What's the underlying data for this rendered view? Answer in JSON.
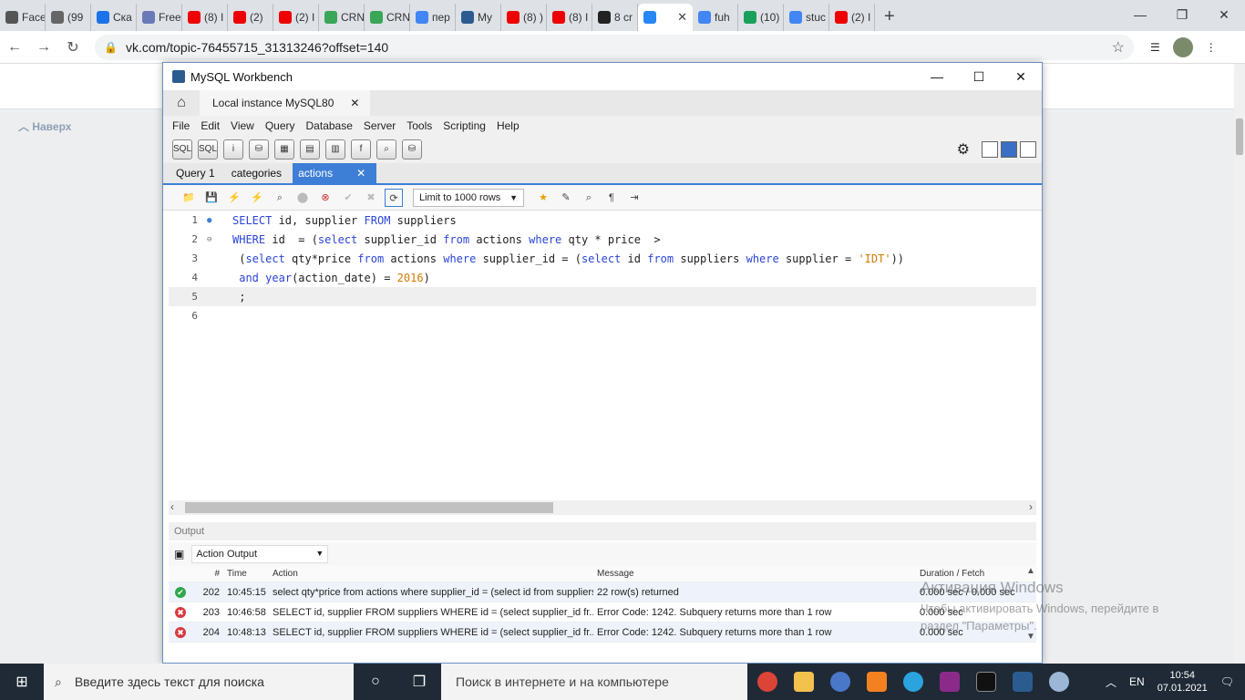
{
  "browser": {
    "tabs": [
      {
        "label": "Face",
        "color": "#555"
      },
      {
        "label": "(99",
        "color": "#666"
      },
      {
        "label": "Ска",
        "color": "#1a73e8"
      },
      {
        "label": "Free",
        "color": "#6a7ab8"
      },
      {
        "label": "(8) I",
        "color": "#e00"
      },
      {
        "label": "(2)",
        "color": "#e00"
      },
      {
        "label": "(2) I",
        "color": "#e00"
      },
      {
        "label": "CRN",
        "color": "#3aa657"
      },
      {
        "label": "CRN",
        "color": "#3aa657"
      },
      {
        "label": "пер",
        "color": "#4285f4"
      },
      {
        "label": "My",
        "color": "#2c5c8f"
      },
      {
        "label": "(8) )",
        "color": "#e00"
      },
      {
        "label": "(8) I",
        "color": "#e00"
      },
      {
        "label": "8 cr",
        "color": "#222"
      },
      {
        "label": "",
        "color": "#2787f5"
      },
      {
        "label": "fuh",
        "color": "#4285f4"
      },
      {
        "label": "(10)",
        "color": "#1aa05a"
      },
      {
        "label": "stuc",
        "color": "#4285f4"
      },
      {
        "label": "(2) I",
        "color": "#e00"
      }
    ],
    "url": "vk.com/topic-76455715_31313246?offset=140"
  },
  "vk": {
    "naverh": "Наверх"
  },
  "workbench": {
    "title": "MySQL Workbench",
    "connection_tab": "Local instance MySQL80",
    "menu": [
      "File",
      "Edit",
      "View",
      "Query",
      "Database",
      "Server",
      "Tools",
      "Scripting",
      "Help"
    ],
    "query_tabs": [
      "Query 1",
      "categories",
      "actions"
    ],
    "limit": "Limit to 1000 rows",
    "output_label": "Output",
    "output_select": "Action Output",
    "grid_headers": {
      "num": "#",
      "time": "Time",
      "action": "Action",
      "message": "Message",
      "duration": "Duration / Fetch"
    },
    "rows": [
      {
        "status": "ok",
        "num": "202",
        "time": "10:45:15",
        "action": "select qty*price from actions where supplier_id = (select id from suppliers...",
        "message": "22 row(s) returned",
        "duration": "0.000 sec / 0.000 sec"
      },
      {
        "status": "error",
        "num": "203",
        "time": "10:46:58",
        "action": "SELECT id, supplier FROM suppliers WHERE id  = (select supplier_id fr...",
        "message": "Error Code: 1242. Subquery returns more than 1 row",
        "duration": "0.000 sec"
      },
      {
        "status": "error",
        "num": "204",
        "time": "10:48:13",
        "action": "SELECT id, supplier FROM suppliers WHERE id  = (select supplier_id fr...",
        "message": "Error Code: 1242. Subquery returns more than 1 row",
        "duration": "0.000 sec"
      }
    ]
  },
  "watermark": {
    "line1": "Активация Windows",
    "line2": "Чтобы активировать Windows, перейдите в",
    "line3": "раздел \"Параметры\"."
  },
  "taskbar": {
    "search_placeholder": "Введите здесь текст для поиска",
    "web_search": "Поиск в интернете и на компьютере",
    "lang": "EN",
    "time": "10:54",
    "date": "07.01.2021"
  }
}
